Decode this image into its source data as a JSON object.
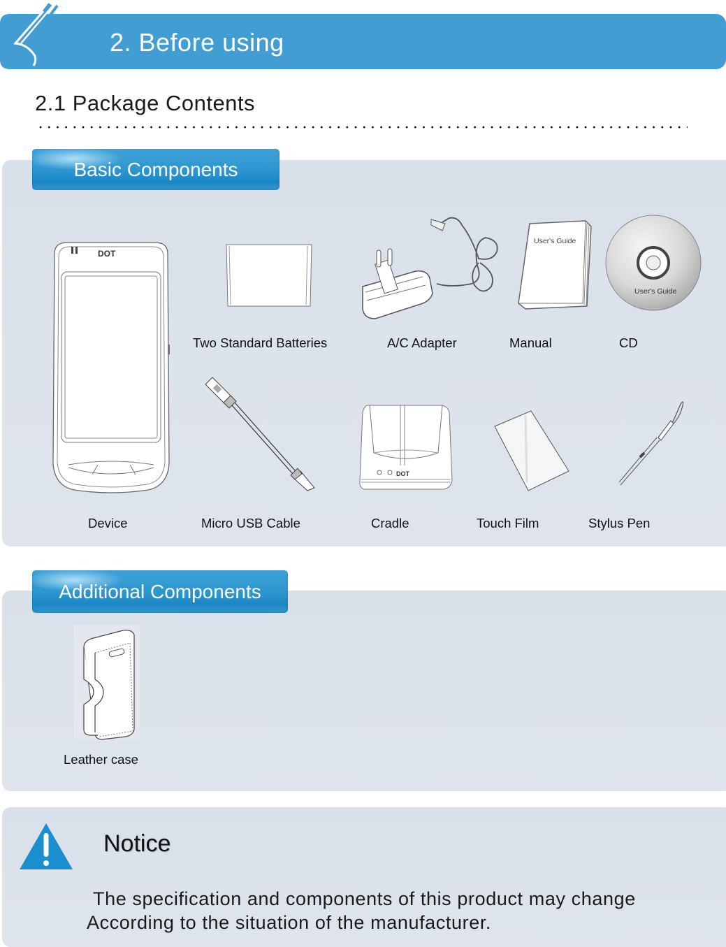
{
  "header": {
    "title": "2. Before using",
    "bar_color": "#429ed2",
    "logo_icon": "page-curl-logo-icon"
  },
  "section": {
    "title": "2.1 Package Contents"
  },
  "basic_components": {
    "heading": "Basic Components",
    "items": [
      {
        "label": "Device",
        "icon": "device-icon"
      },
      {
        "label": "Two Standard Batteries",
        "icon": "battery-icon"
      },
      {
        "label": "A/C Adapter",
        "icon": "ac-adapter-icon"
      },
      {
        "label": "Manual",
        "icon": "manual-icon",
        "cover_text": "User's Guide"
      },
      {
        "label": "CD",
        "icon": "cd-icon",
        "disc_text": "User's Guide"
      },
      {
        "label": "Micro USB Cable",
        "icon": "usb-cable-icon"
      },
      {
        "label": "Cradle",
        "icon": "cradle-icon",
        "brand": "DOT"
      },
      {
        "label": "Touch Film",
        "icon": "touch-film-icon"
      },
      {
        "label": "Stylus Pen",
        "icon": "stylus-pen-icon"
      }
    ],
    "device_brand": "DOT"
  },
  "additional_components": {
    "heading": "Additional Components",
    "items": [
      {
        "label": "Leather case",
        "icon": "leather-case-icon"
      }
    ]
  },
  "notice": {
    "heading": "Notice",
    "icon": "warning-triangle-icon",
    "icon_color": "#1a8fd0",
    "line1": "The specification and components of this product may change",
    "line2": "According to the situation of the manufacturer."
  }
}
